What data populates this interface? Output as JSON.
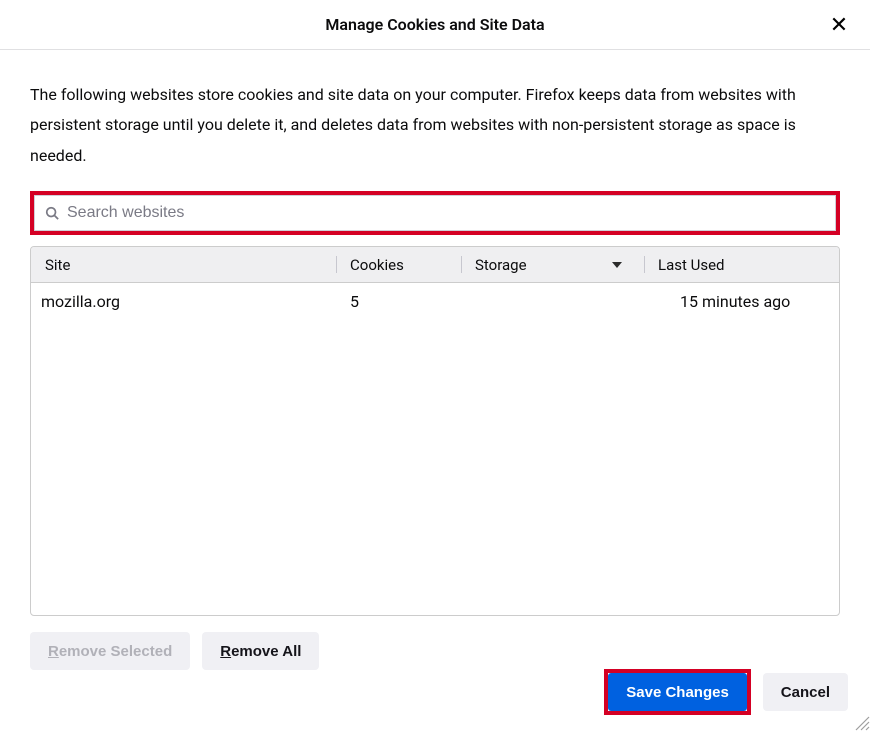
{
  "dialog": {
    "title": "Manage Cookies and Site Data",
    "description": "The following websites store cookies and site data on your computer. Firefox keeps data from websites with persistent storage until you delete it, and deletes data from websites with non-persistent storage as space is needed."
  },
  "search": {
    "placeholder": "Search websites"
  },
  "table": {
    "headers": {
      "site": "Site",
      "cookies": "Cookies",
      "storage": "Storage",
      "last_used": "Last Used"
    },
    "rows": [
      {
        "site": "mozilla.org",
        "cookies": "5",
        "storage": "",
        "last_used": "15 minutes ago"
      }
    ]
  },
  "buttons": {
    "remove_selected": "Remove Selected",
    "remove_all": "Remove All",
    "save_changes": "Save Changes",
    "cancel": "Cancel"
  }
}
